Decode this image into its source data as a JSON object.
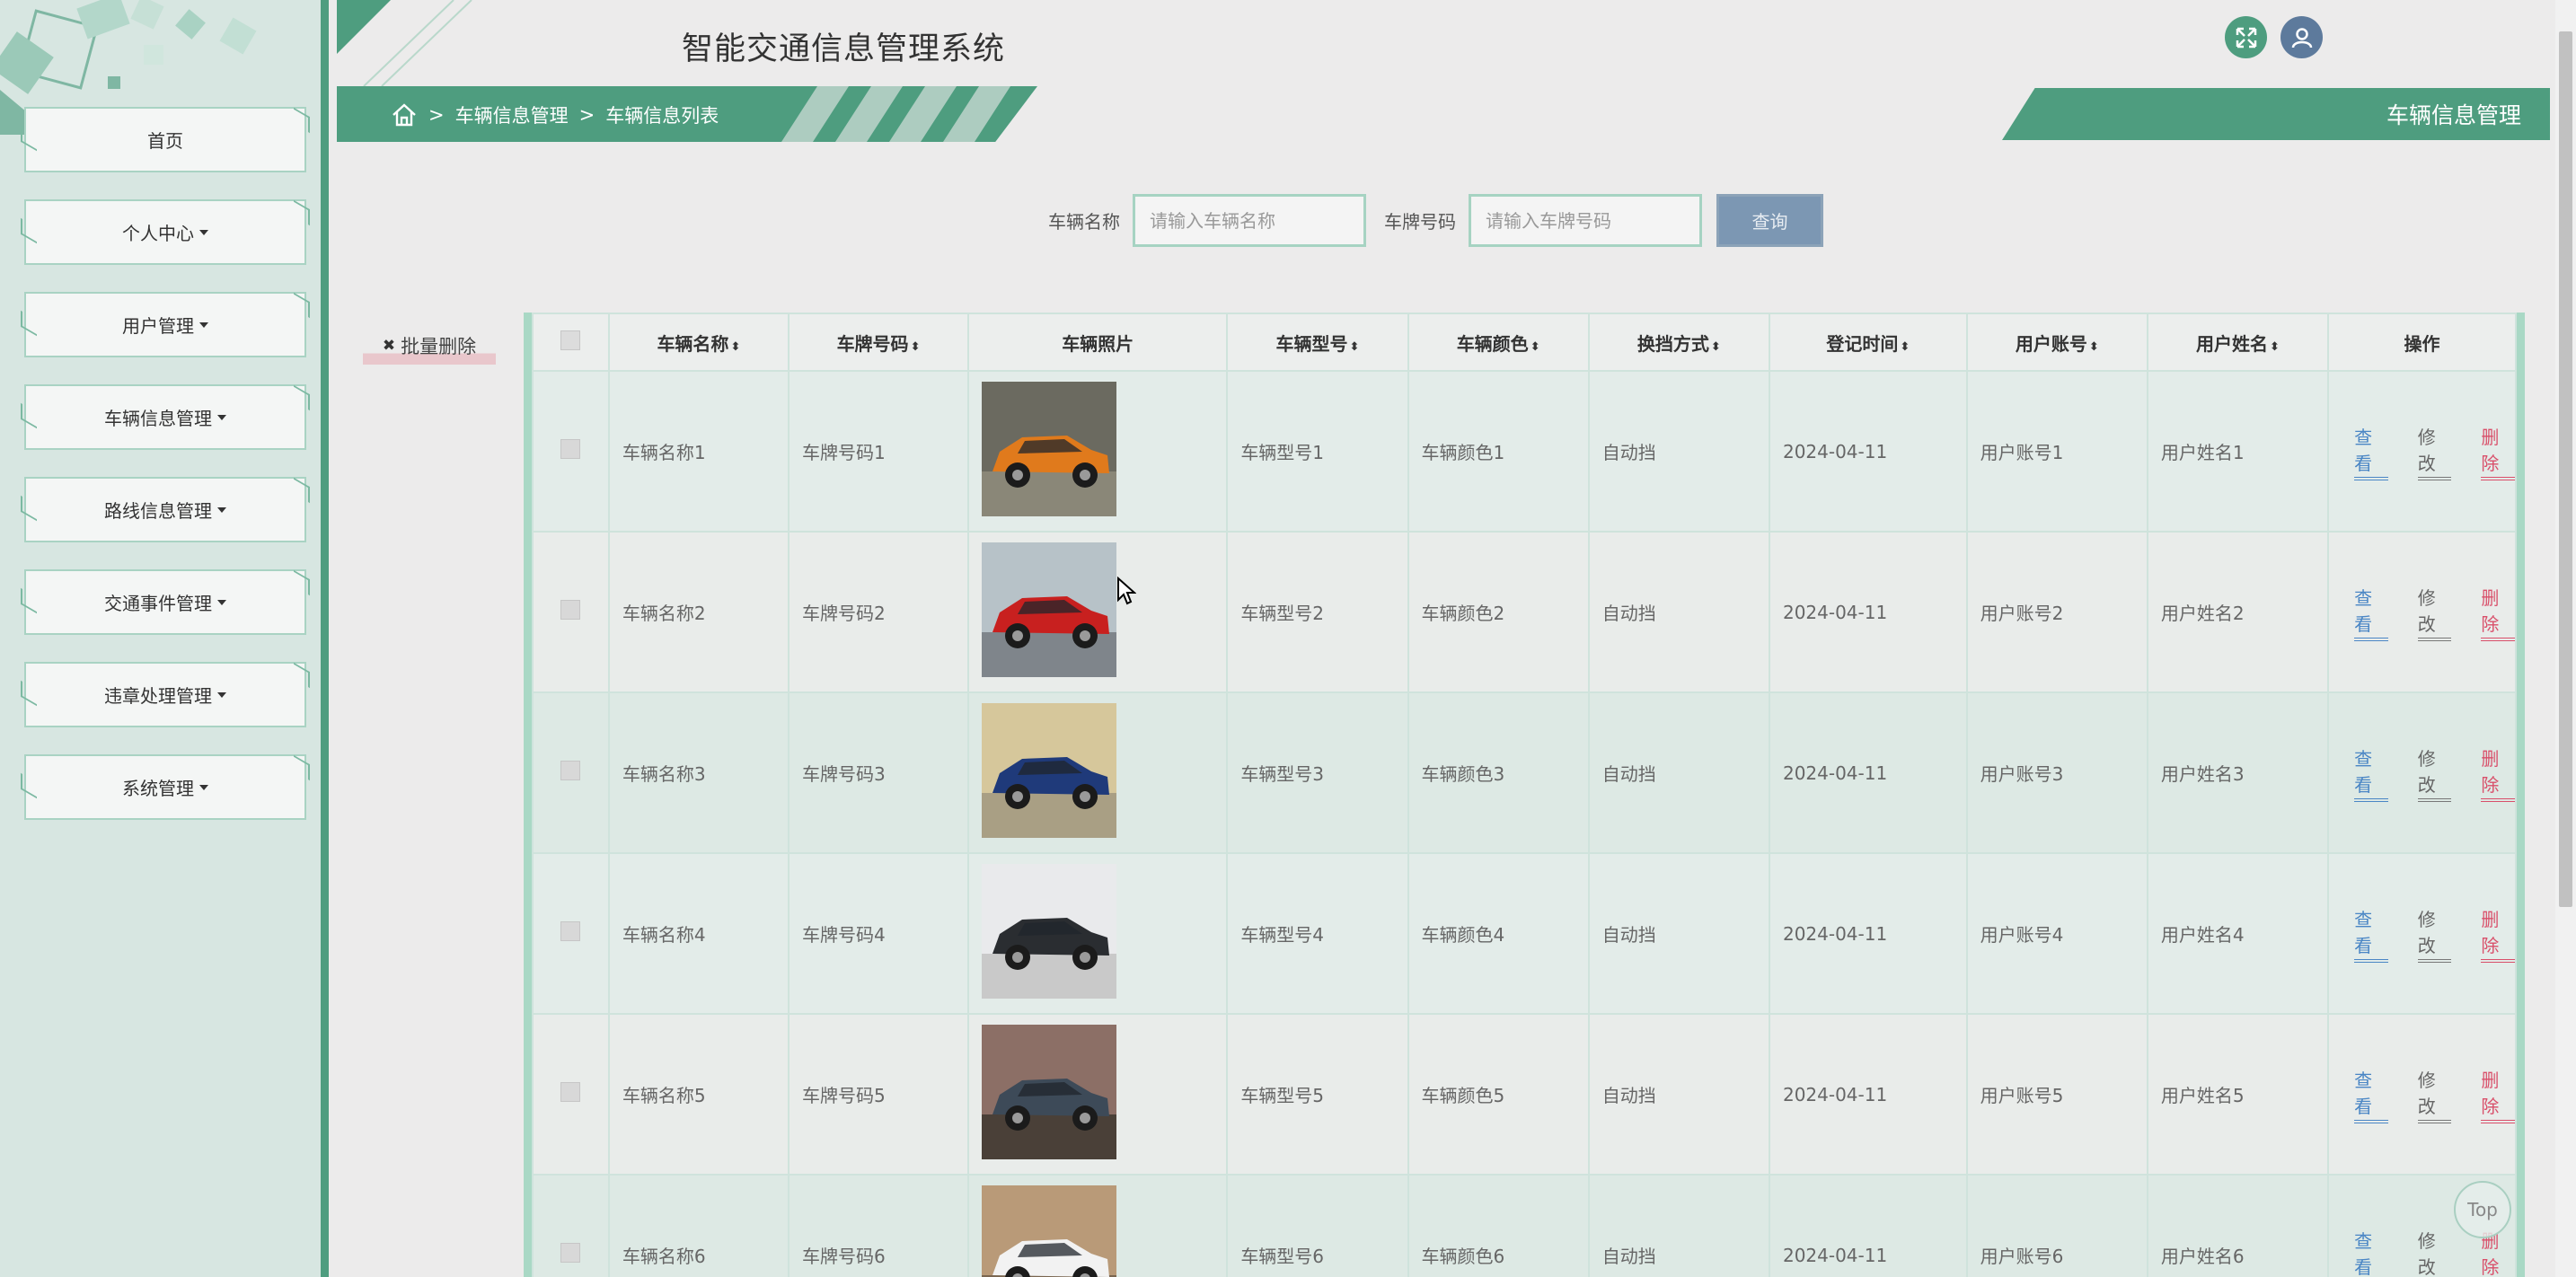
{
  "app": {
    "title": "智能交通信息管理系统",
    "accent": "#4e9d7f"
  },
  "sidebar": {
    "items": [
      {
        "label": "首页",
        "has_caret": false
      },
      {
        "label": "个人中心",
        "has_caret": true
      },
      {
        "label": "用户管理",
        "has_caret": true
      },
      {
        "label": "车辆信息管理",
        "has_caret": true
      },
      {
        "label": "路线信息管理",
        "has_caret": true
      },
      {
        "label": "交通事件管理",
        "has_caret": true
      },
      {
        "label": "违章处理管理",
        "has_caret": true
      },
      {
        "label": "系统管理",
        "has_caret": true
      }
    ]
  },
  "header": {
    "fullscreen_icon": "fullscreen-icon",
    "user_icon": "user-icon"
  },
  "breadcrumb": {
    "home_icon": "home-icon",
    "sep": ">",
    "items": [
      "车辆信息管理",
      "车辆信息列表"
    ]
  },
  "page_tag": "车辆信息管理",
  "search": {
    "name_label": "车辆名称",
    "name_placeholder": "请输入车辆名称",
    "plate_label": "车牌号码",
    "plate_placeholder": "请输入车牌号码",
    "query_label": "查询"
  },
  "batch_delete": {
    "icon": "✖",
    "label": "批量删除"
  },
  "table": {
    "headers": [
      {
        "label": "车辆名称",
        "sortable": true
      },
      {
        "label": "车牌号码",
        "sortable": true
      },
      {
        "label": "车辆照片",
        "sortable": false
      },
      {
        "label": "车辆型号",
        "sortable": true
      },
      {
        "label": "车辆颜色",
        "sortable": true
      },
      {
        "label": "换挡方式",
        "sortable": true
      },
      {
        "label": "登记时间",
        "sortable": true
      },
      {
        "label": "用户账号",
        "sortable": true
      },
      {
        "label": "用户姓名",
        "sortable": true
      },
      {
        "label": "操作",
        "sortable": false
      }
    ],
    "sort_glyph": "⬍",
    "rows": [
      {
        "name": "车辆名称1",
        "plate": "车牌号码1",
        "photo": "orange-car",
        "model": "车辆型号1",
        "color": "车辆颜色1",
        "gear": "自动挡",
        "date": "2024-04-11",
        "account": "用户账号1",
        "username": "用户姓名1"
      },
      {
        "name": "车辆名称2",
        "plate": "车牌号码2",
        "photo": "red-car",
        "model": "车辆型号2",
        "color": "车辆颜色2",
        "gear": "自动挡",
        "date": "2024-04-11",
        "account": "用户账号2",
        "username": "用户姓名2"
      },
      {
        "name": "车辆名称3",
        "plate": "车牌号码3",
        "photo": "blue-car",
        "model": "车辆型号3",
        "color": "车辆颜色3",
        "gear": "自动挡",
        "date": "2024-04-11",
        "account": "用户账号3",
        "username": "用户姓名3"
      },
      {
        "name": "车辆名称4",
        "plate": "车牌号码4",
        "photo": "black-suv",
        "model": "车辆型号4",
        "color": "车辆颜色4",
        "gear": "自动挡",
        "date": "2024-04-11",
        "account": "用户账号4",
        "username": "用户姓名4"
      },
      {
        "name": "车辆名称5",
        "plate": "车牌号码5",
        "photo": "gray-suv",
        "model": "车辆型号5",
        "color": "车辆颜色5",
        "gear": "自动挡",
        "date": "2024-04-11",
        "account": "用户账号5",
        "username": "用户姓名5"
      },
      {
        "name": "车辆名称6",
        "plate": "车牌号码6",
        "photo": "white-suv",
        "model": "车辆型号6",
        "color": "车辆颜色6",
        "gear": "自动挡",
        "date": "2024-04-11",
        "account": "用户账号6",
        "username": "用户姓名6"
      }
    ],
    "actions": {
      "view": "查看",
      "edit": "修改",
      "delete": "删除"
    }
  },
  "top_button": "Top"
}
